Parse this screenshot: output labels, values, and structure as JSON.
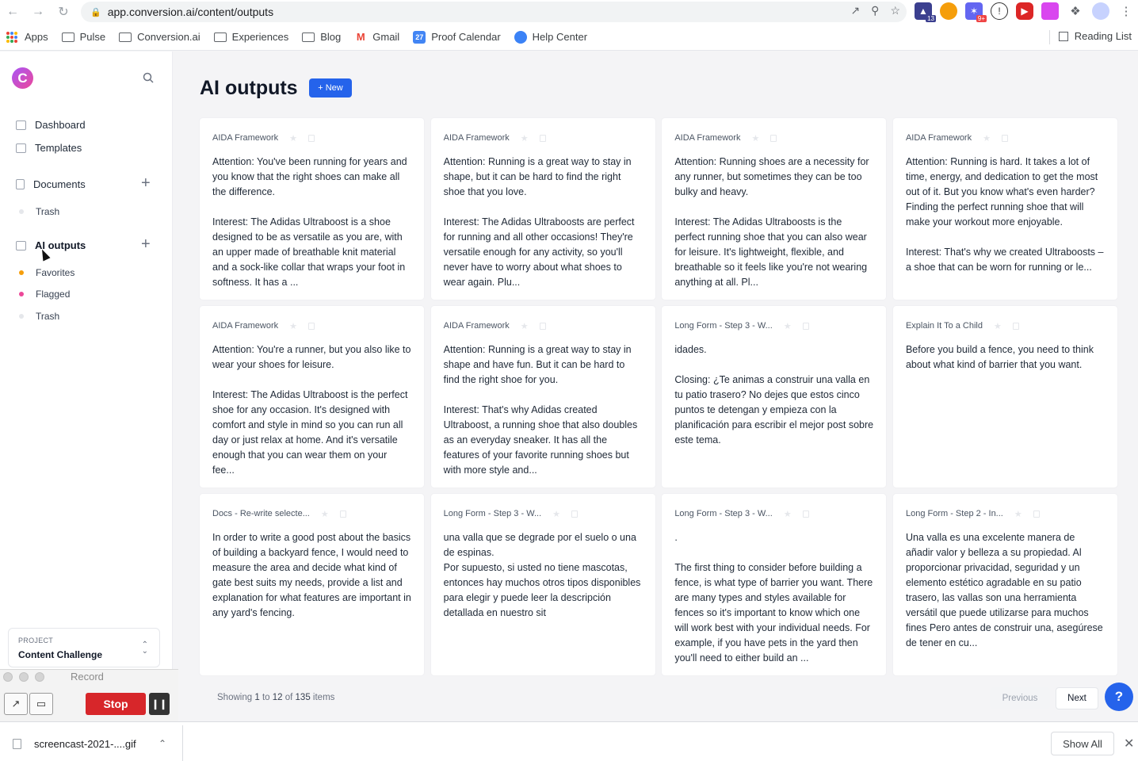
{
  "browser": {
    "url": "app.conversion.ai/content/outputs",
    "bookmarks": [
      "Apps",
      "Pulse",
      "Conversion.ai",
      "Experiences",
      "Blog",
      "Gmail",
      "Proof Calendar",
      "Help Center"
    ],
    "reading_list": "Reading List",
    "ext_badges": [
      "13",
      "9+"
    ]
  },
  "sidebar": {
    "logo": "C",
    "dashboard": "Dashboard",
    "templates": "Templates",
    "documents": "Documents",
    "documents_trash": "Trash",
    "ai_outputs": "AI outputs",
    "favorites": "Favorites",
    "flagged": "Flagged",
    "outputs_trash": "Trash",
    "project_label": "PROJECT",
    "project_name": "Content Challenge"
  },
  "main": {
    "title": "AI outputs",
    "new_button": "+ New",
    "cards": [
      {
        "template": "AIDA Framework",
        "text": "Attention: You've been running for years and you know that the right shoes can make all the difference.\n\nInterest: The Adidas Ultraboost is a shoe designed to be as versatile as you are, with an upper made of breathable knit material and a sock-like collar that wraps your foot in softness. It has a ..."
      },
      {
        "template": "AIDA Framework",
        "text": "Attention: Running is a great way to stay in shape, but it can be hard to find the right shoe that you love.\n\nInterest: The Adidas Ultraboosts are perfect for running and all other occasions! They're versatile enough for any activity, so you'll never have to worry about what shoes to wear again. Plu..."
      },
      {
        "template": "AIDA Framework",
        "text": "Attention: Running shoes are a necessity for any runner, but sometimes they can be too bulky and heavy.\n\nInterest: The Adidas Ultraboosts is the perfect running shoe that you can also wear for leisure. It's lightweight, flexible, and breathable so it feels like you're not wearing anything at all. Pl..."
      },
      {
        "template": "AIDA Framework",
        "text": "Attention: Running is hard. It takes a lot of time, energy, and dedication to get the most out of it. But you know what's even harder? Finding the perfect running shoe that will make your workout more enjoyable.\n\nInterest: That's why we created Ultraboosts – a shoe that can be worn for running or le..."
      },
      {
        "template": "AIDA Framework",
        "text": "Attention: You're a runner, but you also like to wear your shoes for leisure.\n\nInterest: The Adidas Ultraboost is the perfect shoe for any occasion. It's designed with comfort and style in mind so you can run all day or just relax at home. And it's versatile enough that you can wear them on your fee..."
      },
      {
        "template": "AIDA Framework",
        "text": "Attention: Running is a great way to stay in shape and have fun. But it can be hard to find the right shoe for you.\n\nInterest: That's why Adidas created Ultraboost, a running shoe that also doubles as an everyday sneaker. It has all the features of your favorite running shoes but with more style and..."
      },
      {
        "template": "Long Form - Step 3 - W...",
        "text": "idades.\n\nClosing: ¿Te animas a construir una valla en tu patio trasero? No dejes que estos cinco puntos te detengan y empieza con la planificación para escribir el mejor post sobre este tema."
      },
      {
        "template": "Explain It To a Child",
        "text": "Before you build a fence, you need to think about what kind of barrier that you want."
      },
      {
        "template": "Docs - Re-write selecte...",
        "text": "In order to write a good post about the basics of building a backyard fence, I would need to measure the area and decide what kind of gate best suits my needs, provide a list and explanation for what features are important in any yard's fencing."
      },
      {
        "template": "Long Form - Step 3 - W...",
        "text": "una valla que se degrade por el suelo o una de espinas.\nPor supuesto, si usted no tiene mascotas, entonces hay muchos otros tipos disponibles para elegir y puede leer la descripción detallada en nuestro sit"
      },
      {
        "template": "Long Form - Step 3 - W...",
        "text": ".\n\nThe first thing to consider before building a fence, is what type of barrier you want. There are many types and styles available for fences so it's important to know which one will work best with your individual needs. For example, if you have pets in the yard then you'll need to either build an ..."
      },
      {
        "template": "Long Form - Step 2 - In...",
        "text": "Una valla es una excelente manera de añadir valor y belleza a su propiedad. Al proporcionar privacidad, seguridad y un elemento estético agradable en su patio trasero, las vallas son una herramienta versátil que puede utilizarse para muchos fines Pero antes de construir una, asegúrese de tener en cu..."
      }
    ],
    "pagination": {
      "showing_prefix": "Showing",
      "from": "1",
      "to_word": "to",
      "to": "12",
      "of_word": "of",
      "total": "135",
      "suffix": "items",
      "previous": "Previous",
      "next": "Next"
    },
    "help": "?"
  },
  "recorder": {
    "label": "Record",
    "stop": "Stop"
  },
  "downloads": {
    "file": "screencast-2021-....gif",
    "show_all": "Show All"
  },
  "colors": {
    "accent": "#2563eb",
    "favorites_dot": "#f59e0b",
    "flagged_dot": "#ec4899",
    "trash_dot": "#e5e7eb",
    "stop": "#d7262a"
  }
}
